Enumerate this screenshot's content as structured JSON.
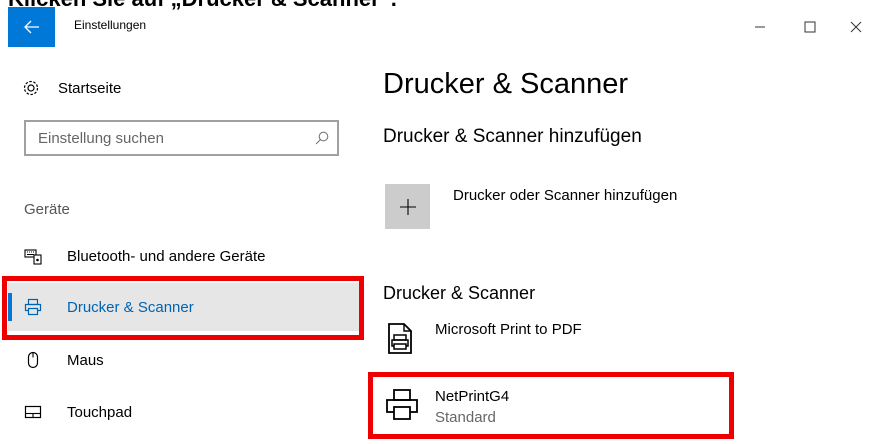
{
  "instruction": "Klicken Sie auf „Drucker & Scanner“.",
  "window": {
    "title": "Einstellungen",
    "controls": {
      "minimize": "—",
      "maximize": "☐",
      "close": "✕"
    }
  },
  "sidebar": {
    "home_label": "Startseite",
    "search_placeholder": "Einstellung suchen",
    "section_label": "Geräte",
    "items": [
      {
        "label": "Bluetooth- und andere Geräte",
        "icon": "keyboard-icon"
      },
      {
        "label": "Drucker & Scanner",
        "icon": "printer-icon",
        "selected": true
      },
      {
        "label": "Maus",
        "icon": "mouse-icon"
      },
      {
        "label": "Touchpad",
        "icon": "touchpad-icon"
      }
    ]
  },
  "main": {
    "title": "Drucker & Scanner",
    "add_section_title": "Drucker & Scanner hinzufügen",
    "add_button_label": "Drucker oder Scanner hinzufügen",
    "devices_section_title": "Drucker & Scanner",
    "devices": [
      {
        "name": "Microsoft Print to PDF",
        "status": "",
        "icon": "pdf-printer-icon"
      },
      {
        "name": "NetPrintG4",
        "status": "Standard",
        "icon": "printer-icon"
      }
    ]
  },
  "colors": {
    "accent": "#0078d7",
    "highlight": "#ee0000",
    "selected_bg": "#e6e6e6"
  }
}
